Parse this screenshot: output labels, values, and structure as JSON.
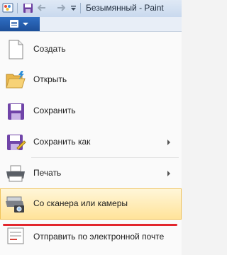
{
  "window": {
    "title": "Безымянный - Paint",
    "quick_access_icons": [
      "paint-app-icon",
      "save-icon",
      "undo-icon",
      "redo-icon",
      "customize-dropdown-icon"
    ]
  },
  "menu_button": {
    "icon": "menu-list-icon",
    "dropdown": "chevron-down-icon"
  },
  "menu": {
    "items": [
      {
        "label": "Создать",
        "icon": "new-document-icon",
        "has_submenu": false
      },
      {
        "label": "Открыть",
        "icon": "open-folder-icon",
        "has_submenu": false
      },
      {
        "label": "Сохранить",
        "icon": "save-disk-icon",
        "has_submenu": false
      },
      {
        "label": "Сохранить как",
        "icon": "save-as-icon",
        "has_submenu": true
      },
      {
        "label": "Печать",
        "icon": "printer-icon",
        "has_submenu": true
      },
      {
        "label": "Со сканера или камеры",
        "icon": "scanner-camera-icon",
        "has_submenu": false,
        "highlighted": true
      },
      {
        "label": "Отправить по электронной почте",
        "icon": "email-icon",
        "has_submenu": false
      }
    ]
  },
  "colors": {
    "highlight": "#ffe39a",
    "annotation_line": "#e2262c",
    "menu_button": "#2a63b5"
  }
}
